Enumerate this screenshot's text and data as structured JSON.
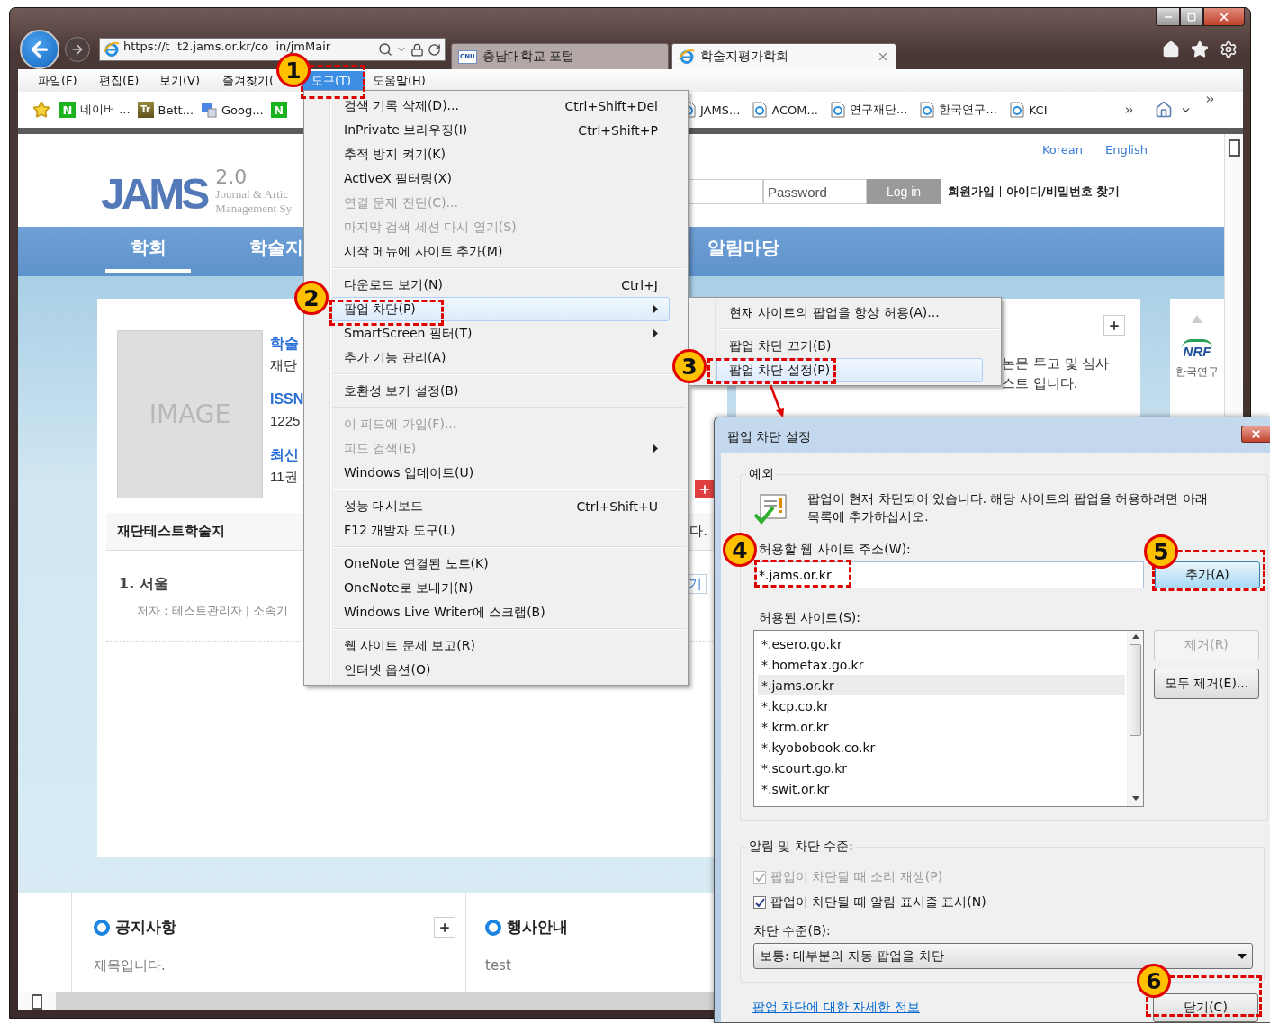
{
  "browser": {
    "address": "https://t  t2.jams.or.kr/co  in/jmMair",
    "tabs": [
      {
        "label": "충남대학교 포털",
        "logo_text": "CNU",
        "selected": false
      },
      {
        "label": "학술지평가학회",
        "selected": true
      }
    ]
  },
  "menu_bar": [
    {
      "label": "파일(F)",
      "selected": false
    },
    {
      "label": "편집(E)",
      "selected": false
    },
    {
      "label": "보기(V)",
      "selected": false
    },
    {
      "label": "즐겨찾기(",
      "selected": false
    },
    {
      "label": "도구(T)",
      "selected": true
    },
    {
      "label": "도움말(H)",
      "selected": false
    }
  ],
  "favorites_left": [
    {
      "kind": "star"
    },
    {
      "kind": "letter",
      "icon_text": "N",
      "label": "네이버 ..."
    },
    {
      "kind": "letter",
      "icon_text": "Tr",
      "label": "Bett..."
    },
    {
      "kind": "google",
      "label": "Goog..."
    },
    {
      "kind": "letter",
      "icon_text": "N"
    }
  ],
  "favorites_right": [
    {
      "kind": "page",
      "label": "JAMS..."
    },
    {
      "kind": "page",
      "label": "ACOM..."
    },
    {
      "kind": "page",
      "label": "연구재단..."
    },
    {
      "kind": "page",
      "label": "한국연구..."
    },
    {
      "kind": "page",
      "label": "KCI"
    }
  ],
  "page": {
    "lang_links": [
      "Korean",
      "English"
    ],
    "logo": {
      "mark": "JAMS",
      "version": "2.0",
      "line1": "Journal & Artic",
      "line2": "Management Sy"
    },
    "login": {
      "password_placeholder": "Password",
      "button": "Log in",
      "links": [
        "회원가입",
        "아이디/비밀번호 찾기"
      ]
    },
    "nav": [
      {
        "label": "학회",
        "selected": true
      },
      {
        "label": "학술지",
        "selected": false
      },
      {
        "label": "알림마당",
        "selected": false
      }
    ],
    "journal": {
      "image_label": "IMAGE",
      "lines": [
        {
          "kind": "title",
          "text": "학술"
        },
        {
          "kind": "body",
          "text": "재단"
        },
        {
          "kind": "title",
          "text": "ISSN"
        },
        {
          "kind": "body",
          "text": "1225"
        },
        {
          "kind": "title",
          "text": "최신"
        },
        {
          "kind": "body",
          "text": "11권"
        }
      ],
      "section_title": "재단테스트학술지",
      "section_tail": "다.",
      "article_title": "1. 서울",
      "article_meta": "저자 : 테스트관리자 | 소속기",
      "article_button": "기"
    },
    "notice": [
      "논문 투고 및 심사",
      "스트 입니다."
    ],
    "partner": {
      "logo_text": "NRF",
      "caption": "한국연구"
    },
    "boards": [
      {
        "title": "공지사항",
        "more_button": true,
        "items": [
          "제목입니다."
        ]
      },
      {
        "title": "행사안내",
        "more_button": false,
        "items": [
          "test"
        ]
      }
    ]
  },
  "tools_menu": {
    "groups": [
      [
        {
          "label": "검색 기록 삭제(D)...",
          "shortcut": "Ctrl+Shift+Del",
          "disabled": false,
          "submenu": false,
          "selected": false
        },
        {
          "label": "InPrivate 브라우징(I)",
          "shortcut": "Ctrl+Shift+P",
          "disabled": false,
          "submenu": false,
          "selected": false
        },
        {
          "label": "추적 방지 켜기(K)",
          "disabled": false,
          "submenu": false,
          "selected": false
        },
        {
          "label": "ActiveX 필터링(X)",
          "disabled": false,
          "submenu": false,
          "selected": false
        },
        {
          "label": "연결 문제 진단(C)...",
          "disabled": true,
          "submenu": false,
          "selected": false
        },
        {
          "label": "마지막 검색 세션 다시 열기(S)",
          "disabled": true,
          "submenu": false,
          "selected": false
        },
        {
          "label": "시작 메뉴에 사이트 추가(M)",
          "disabled": false,
          "submenu": false,
          "selected": false
        }
      ],
      [
        {
          "label": "다운로드 보기(N)",
          "shortcut": "Ctrl+J",
          "disabled": false,
          "submenu": false,
          "selected": false
        },
        {
          "label": "팝업 차단(P)",
          "disabled": false,
          "submenu": true,
          "selected": true
        },
        {
          "label": "SmartScreen 필터(T)",
          "disabled": false,
          "submenu": true,
          "selected": false
        },
        {
          "label": "추가 기능 관리(A)",
          "disabled": false,
          "submenu": false,
          "selected": false
        }
      ],
      [
        {
          "label": "호환성 보기 설정(B)",
          "disabled": false,
          "submenu": false,
          "selected": false
        }
      ],
      [
        {
          "label": "이 피드에 가입(F)...",
          "disabled": true,
          "submenu": false,
          "selected": false
        },
        {
          "label": "피드 검색(E)",
          "disabled": true,
          "submenu": true,
          "selected": false
        },
        {
          "label": "Windows 업데이트(U)",
          "disabled": false,
          "submenu": false,
          "selected": false
        }
      ],
      [
        {
          "label": "성능 대시보드",
          "shortcut": "Ctrl+Shift+U",
          "disabled": false,
          "submenu": false,
          "selected": false
        },
        {
          "label": "F12 개발자 도구(L)",
          "disabled": false,
          "submenu": false,
          "selected": false
        }
      ],
      [
        {
          "label": "OneNote 연결된 노트(K)",
          "disabled": false,
          "submenu": false,
          "selected": false
        },
        {
          "label": "OneNote로 보내기(N)",
          "disabled": false,
          "submenu": false,
          "selected": false
        },
        {
          "label": "Windows Live Writer에 스크랩(B)",
          "disabled": false,
          "submenu": false,
          "selected": false
        }
      ],
      [
        {
          "label": "웹 사이트 문제 보고(R)",
          "disabled": false,
          "submenu": false,
          "selected": false
        },
        {
          "label": "인터넷 옵션(O)",
          "disabled": false,
          "submenu": false,
          "selected": false
        }
      ]
    ]
  },
  "popup_submenu": {
    "groups": [
      [
        {
          "label": "현재 사이트의 팝업을 항상 허용(A)...",
          "selected": false
        }
      ],
      [
        {
          "label": "팝업 차단 끄기(B)",
          "selected": false
        },
        {
          "label": "팝업 차단 설정(P)",
          "selected": true
        }
      ]
    ]
  },
  "dialog": {
    "title": "팝업 차단 설정",
    "exceptions": {
      "legend": "예외",
      "message": "팝업이 현재 차단되어 있습니다. 해당 사이트의 팝업을 허용하려면 아래 목록에 추가하십시오.",
      "address_label": "허용할 웹 사이트 주소(W):",
      "address_value": "*.jams.or.kr",
      "add_button": "추가(A)",
      "sites_label": "허용된 사이트(S):",
      "sites": [
        {
          "label": "*.esero.go.kr",
          "selected": false
        },
        {
          "label": "*.hometax.go.kr",
          "selected": false
        },
        {
          "label": "*.jams.or.kr",
          "selected": true
        },
        {
          "label": "*.kcp.co.kr",
          "selected": false
        },
        {
          "label": "*.krm.or.kr",
          "selected": false
        },
        {
          "label": "*.kyobobook.co.kr",
          "selected": false
        },
        {
          "label": "*.scourt.go.kr",
          "selected": false
        },
        {
          "label": "*.swit.or.kr",
          "selected": false
        }
      ],
      "buttons": [
        {
          "label": "제거(R)",
          "disabled": true
        },
        {
          "label": "모두 제거(E)...",
          "disabled": false
        }
      ]
    },
    "notifications": {
      "legend": "알림 및 차단 수준:",
      "options": [
        {
          "label": "팝업이 차단될 때 소리 재생(P)",
          "checked": true,
          "disabled": true
        },
        {
          "label": "팝업이 차단될 때 알림 표시줄 표시(N)",
          "checked": true,
          "disabled": false
        }
      ],
      "level_label": "차단 수준(B):",
      "level_value": "보통: 대부분의 자동 팝업을 차단"
    },
    "help_link": "팝업 차단에 대한 자세한 정보",
    "close_button": "닫기(C)"
  },
  "annotations": [
    {
      "number": "1"
    },
    {
      "number": "2"
    },
    {
      "number": "3"
    },
    {
      "number": "4"
    },
    {
      "number": "5"
    },
    {
      "number": "6"
    }
  ]
}
